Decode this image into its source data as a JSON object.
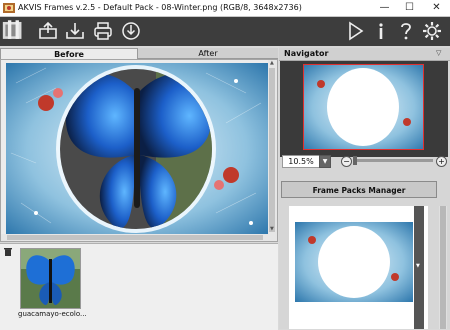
{
  "window": {
    "title": "AKVIS Frames v.2.5 - Default Pack - 08-Winter.png (RGB/8, 3648x2736)",
    "minimize": "—",
    "maximize": "☐",
    "close": "✕"
  },
  "toolbar": {
    "left_icons": [
      "frames-logo-icon",
      "open-icon",
      "save-icon",
      "print-icon",
      "share-icon"
    ],
    "right_icons": [
      "run-icon",
      "info-icon",
      "help-icon",
      "settings-icon"
    ]
  },
  "tabs": {
    "before": "Before",
    "after": "After"
  },
  "navigator": {
    "title": "Navigator",
    "zoom": "10.5%",
    "zoom_minus": "−",
    "zoom_plus": "+"
  },
  "frame_packs": {
    "button_label": "Frame Packs Manager"
  },
  "bottom_panel": {
    "thumbnail_label": "guacamayo-ecolo..."
  },
  "colors": {
    "toolbar_bg": "#3d3d3d",
    "nav_highlight": "#e03030"
  }
}
